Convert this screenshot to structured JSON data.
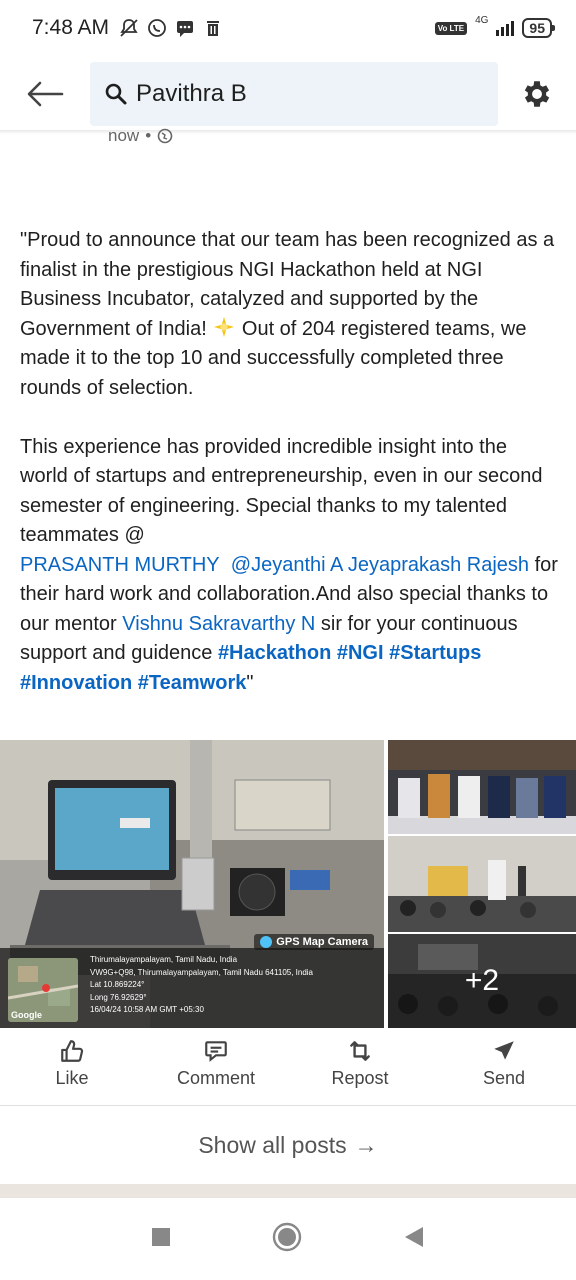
{
  "status_bar": {
    "time": "7:48 AM",
    "network": "4G",
    "volte": "Vo LTE",
    "battery": "95"
  },
  "header": {
    "search_query": "Pavithra B"
  },
  "post": {
    "meta_time": "now",
    "meta_separator": "•",
    "para1_a": "\"Proud to announce that our team has been recognized as a finalist in the prestigious NGI Hackathon held at NGI Business Incubator, catalyzed and supported by the Government of India! ",
    "para1_b": " Out of 204 registered teams, we made it to the top 10 and successfully completed three rounds of selection.",
    "para2_a": "This experience has provided incredible insight into the world of startups and entrepreneurship, even in our second semester of engineering. Special thanks to my talented teammates  @",
    "mention1": "PRASANTH MURTHY",
    "mention2": "@Jeyanthi A Jeyaprakash Rajesh",
    "para2_b": " for their hard work and collaboration.And also special thanks to our mentor ",
    "mention3": "Vishnu Sakravarthy N",
    "para2_c": " sir for your continuous support and guidence ",
    "hashtags": "#Hackathon #NGI #Startups #Innovation #Teamwork",
    "closing_quote": "\""
  },
  "media": {
    "gps_tag": "GPS Map Camera",
    "gps_lines": [
      "Thirumalayampalayam, Tamil Nadu, India",
      "VW9G+Q98, Thirumalayampalayam, Tamil Nadu 641105, India",
      "Lat 10.869224°",
      "Long 76.92629°",
      "16/04/24 10:58 AM GMT +05:30"
    ],
    "map_label": "Google",
    "more_count": "+2"
  },
  "actions": [
    {
      "label": "Like",
      "icon": "thumbs-up-icon"
    },
    {
      "label": "Comment",
      "icon": "comment-icon"
    },
    {
      "label": "Repost",
      "icon": "repost-icon"
    },
    {
      "label": "Send",
      "icon": "send-icon"
    }
  ],
  "show_all": {
    "label": "Show all posts",
    "arrow": "→"
  }
}
